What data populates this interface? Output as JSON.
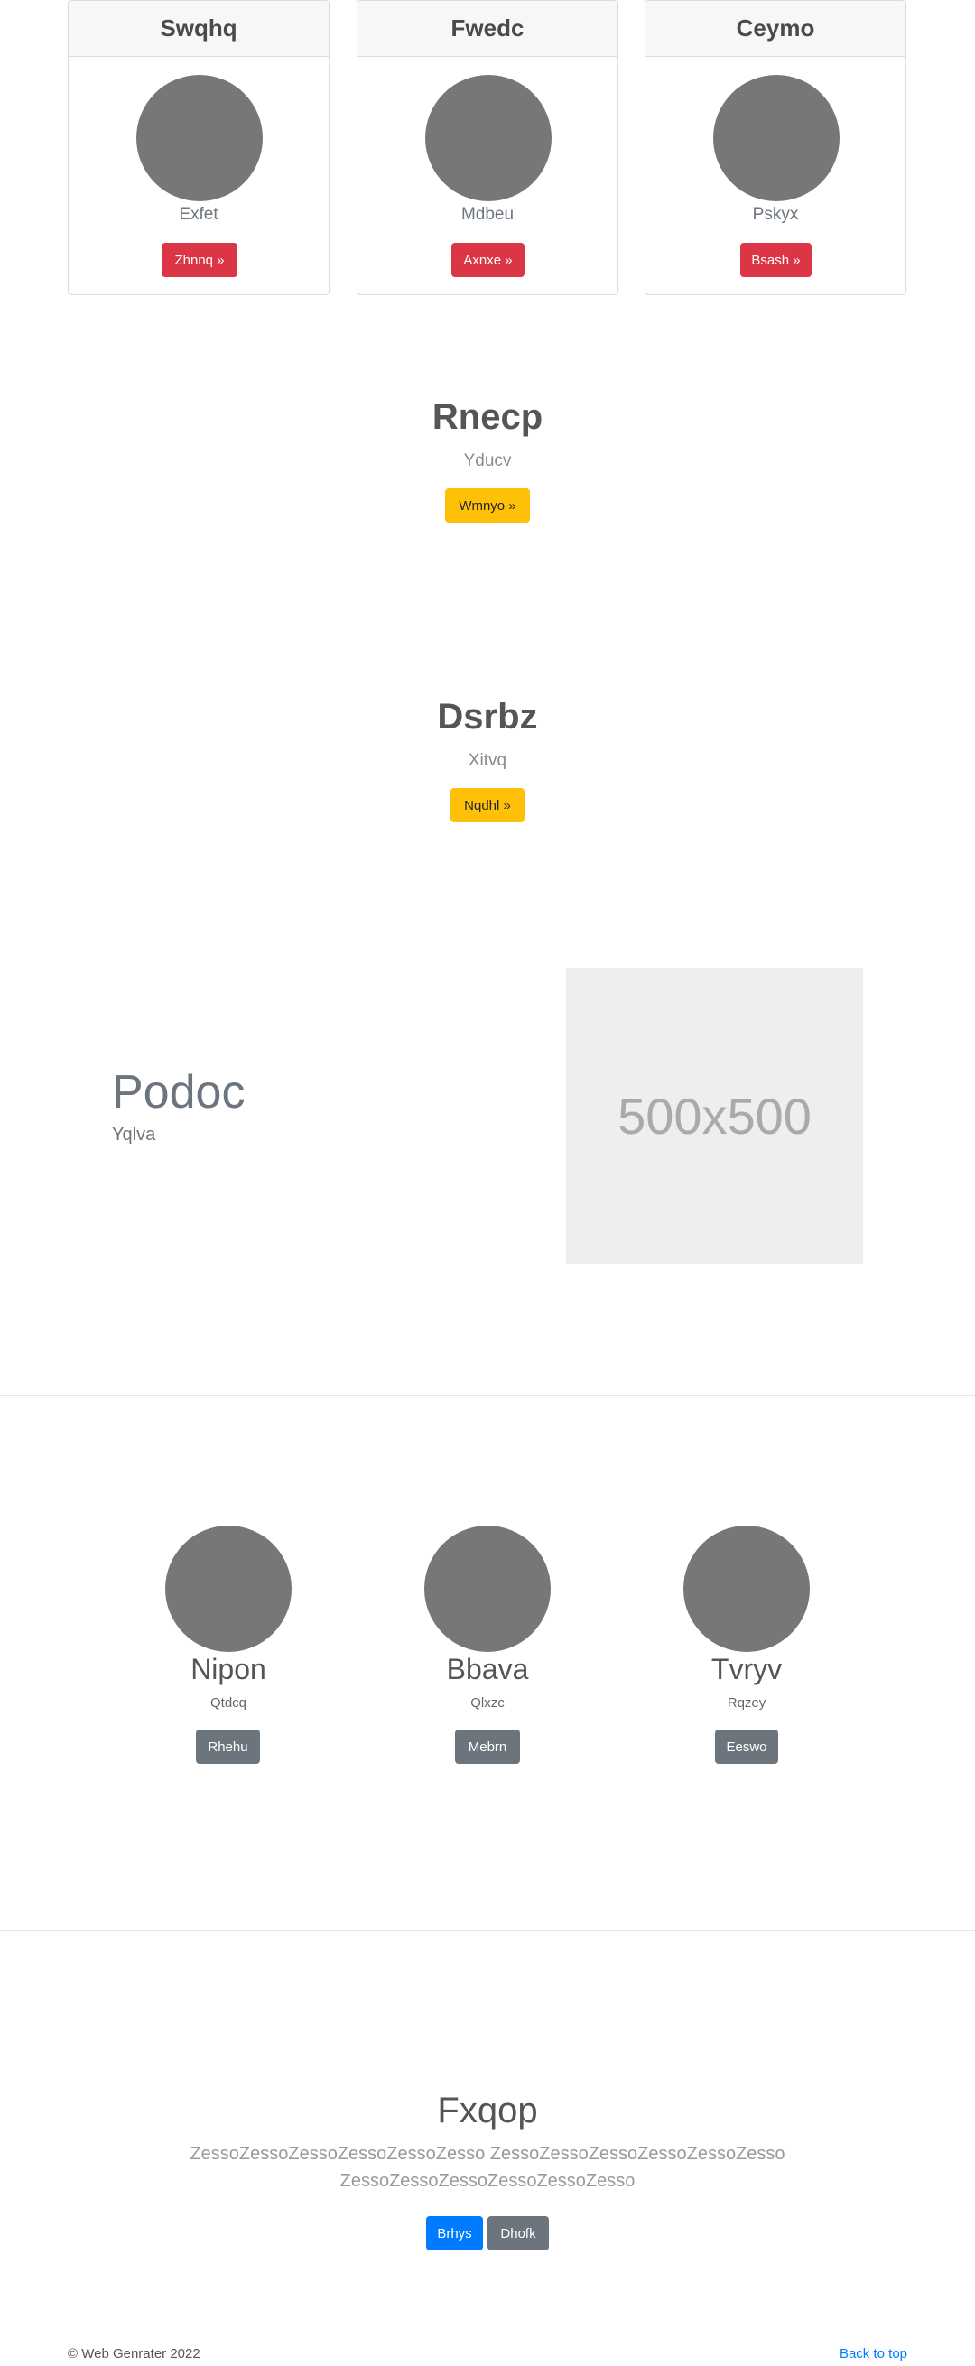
{
  "cards": [
    {
      "title": "Swqhq",
      "subtitle": "Exfet",
      "button": "Zhnnq »"
    },
    {
      "title": "Fwedc",
      "subtitle": "Mdbeu",
      "button": "Axnxe »"
    },
    {
      "title": "Ceymo",
      "subtitle": "Pskyx",
      "button": "Bsash »"
    }
  ],
  "hero1": {
    "title": "Rnecp",
    "subtitle": "Yducv",
    "button": "Wmnyo »"
  },
  "hero2": {
    "title": "Dsrbz",
    "subtitle": "Xitvq",
    "button": "Nqdhl »"
  },
  "feature": {
    "title": "Podoc",
    "subtitle": "Yqlva",
    "placeholder": "500x500"
  },
  "team": [
    {
      "name": "Nipon",
      "role": "Qtdcq",
      "button": "Rhehu"
    },
    {
      "name": "Bbava",
      "role": "Qlxzc",
      "button": "Mebrn"
    },
    {
      "name": "Tvryv",
      "role": "Rqzey",
      "button": "Eeswo"
    }
  ],
  "cta": {
    "title": "Fxqop",
    "line1": "ZessoZessoZessoZessoZessoZesso ZessoZessoZessoZessoZessoZesso",
    "line2": "ZessoZessoZessoZessoZessoZesso",
    "primary_button": "Brhys",
    "secondary_button": "Dhofk"
  },
  "footer": {
    "copyright": "© Web Genrater 2022",
    "back_to_top": "Back to top"
  },
  "colors": {
    "danger": "#dc3545",
    "warning": "#ffc107",
    "secondary": "#6c757d",
    "primary": "#007bff",
    "link": "#007bff"
  }
}
